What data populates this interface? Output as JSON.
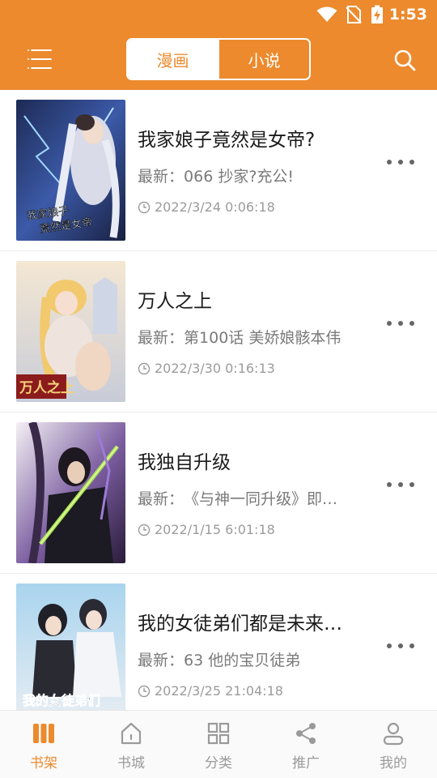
{
  "status": {
    "time": "1:53"
  },
  "header": {
    "tabs": [
      {
        "label": "漫画",
        "active": true
      },
      {
        "label": "小说",
        "active": false
      }
    ],
    "accent_color": "#ec8a2d"
  },
  "books": [
    {
      "title": "我家娘子竟然是女帝?",
      "latest_prefix": "最新：",
      "latest": "066 抄家?充公!",
      "time": "2022/3/24 0:06:18",
      "cover_text": "我家娘子竟然是女帝"
    },
    {
      "title": "万人之上",
      "latest_prefix": "最新：",
      "latest": "第100话 美娇娘骸本伟",
      "time": "2022/3/30 0:16:13",
      "cover_text": "万人之上"
    },
    {
      "title": "我独自升级",
      "latest_prefix": "最新：",
      "latest": "《与神一同升级》即…",
      "time": "2022/1/15 6:01:18"
    },
    {
      "title": "我的女徒弟们都是未来…",
      "latest_prefix": "最新：",
      "latest": "63 他的宝贝徒弟",
      "time": "2022/3/25 21:04:18",
      "cover_text": "我的女徒弟们"
    }
  ],
  "bottom_nav": [
    {
      "label": "书架",
      "icon": "bookshelf-icon",
      "active": true
    },
    {
      "label": "书城",
      "icon": "home-icon",
      "active": false
    },
    {
      "label": "分类",
      "icon": "category-icon",
      "active": false
    },
    {
      "label": "推广",
      "icon": "share-icon",
      "active": false
    },
    {
      "label": "我的",
      "icon": "user-icon",
      "active": false
    }
  ]
}
